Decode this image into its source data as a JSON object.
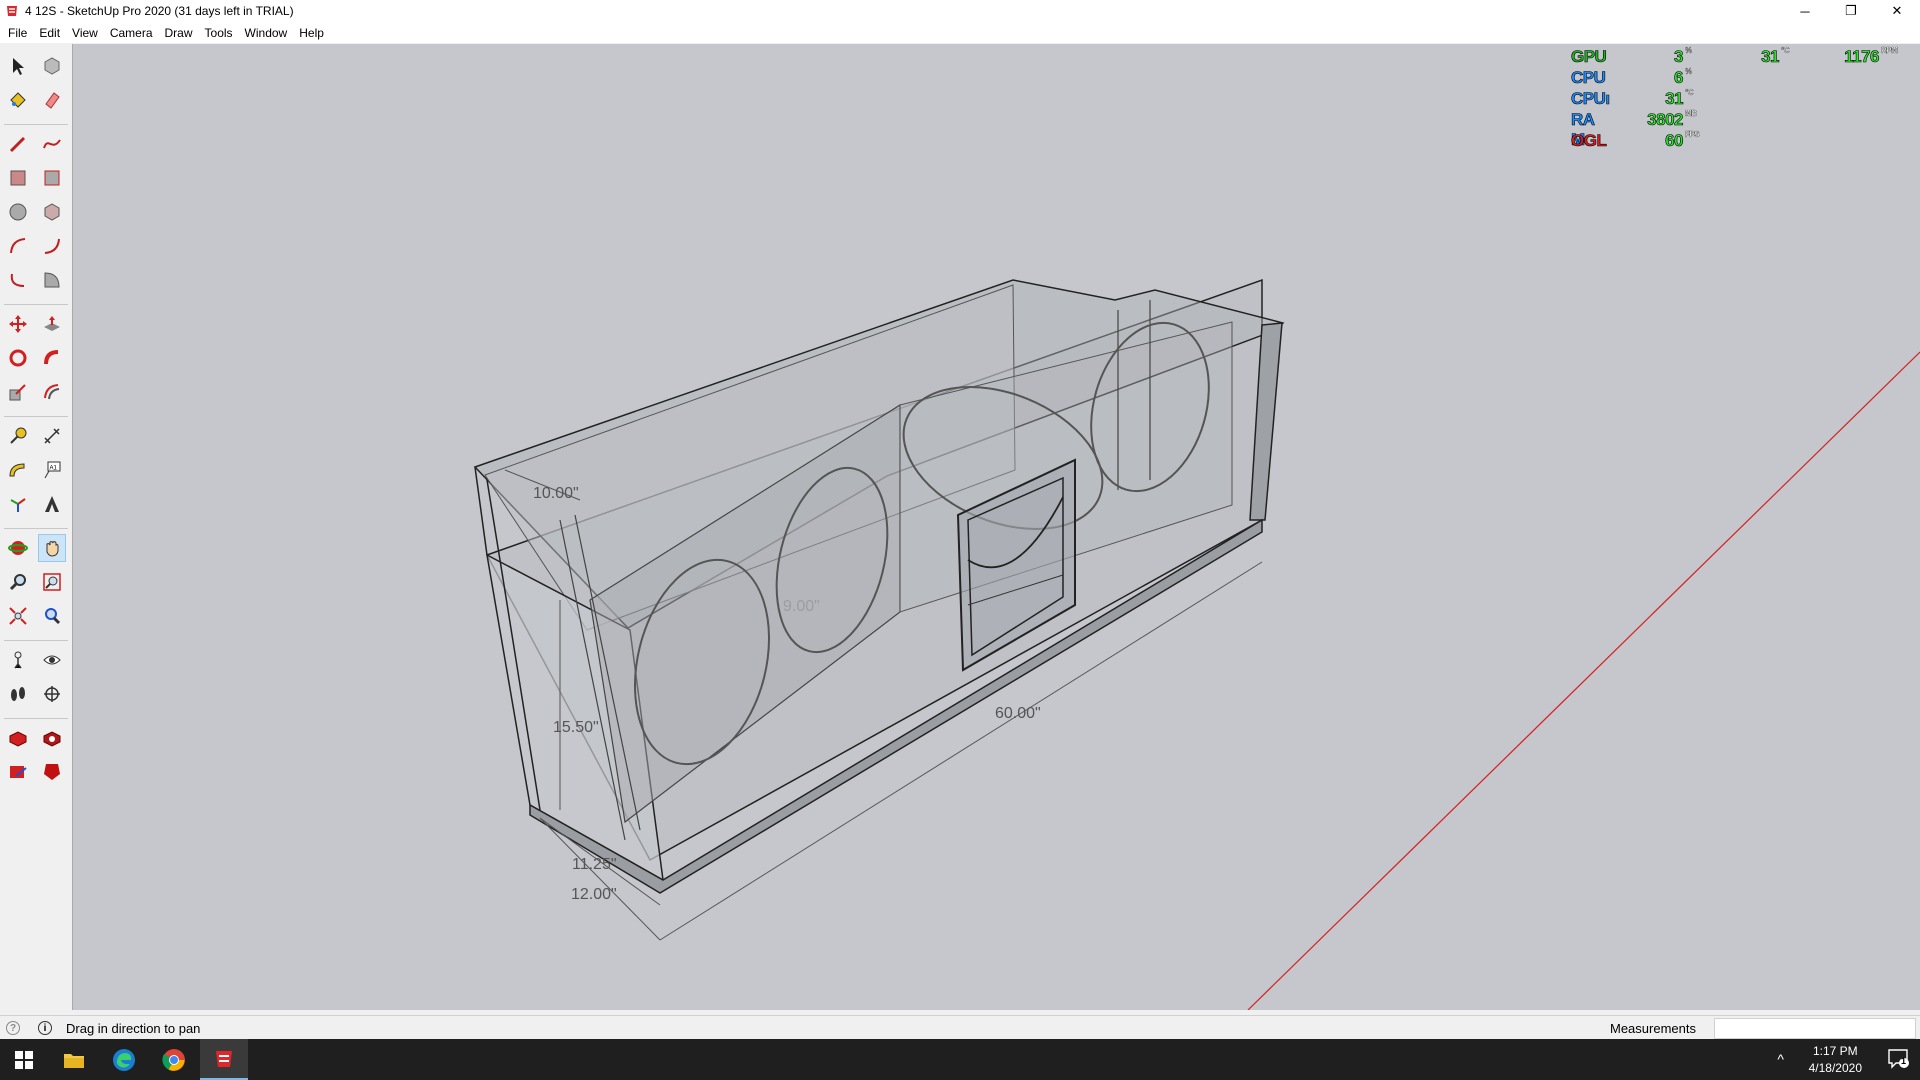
{
  "window": {
    "title": "4 12S - SketchUp Pro 2020 (31 days left in TRIAL)",
    "controls": {
      "minimize": "─",
      "restore": "❐",
      "close": "✕"
    }
  },
  "menu": [
    "File",
    "Edit",
    "View",
    "Camera",
    "Draw",
    "Tools",
    "Window",
    "Help"
  ],
  "toolbar": {
    "tools": [
      "select-icon",
      "component-icon",
      "paint-bucket-icon",
      "eraser-icon",
      "pencil-line-icon",
      "freehand-icon",
      "rectangle-icon",
      "rotated-rectangle-icon",
      "circle-icon",
      "polygon-icon",
      "arc-icon",
      "two-point-arc-icon",
      "three-point-arc-icon",
      "pie-icon",
      "move-icon",
      "push-pull-icon",
      "rotate-icon",
      "follow-me-icon",
      "scale-icon",
      "offset-icon",
      "tape-measure-icon",
      "dimension-icon",
      "protractor-icon",
      "text-icon",
      "axes-icon",
      "3d-text-icon",
      "orbit-icon",
      "pan-icon",
      "zoom-icon",
      "zoom-window-icon",
      "zoom-extents-icon",
      "previous-view-icon",
      "position-camera-icon",
      "look-around-icon",
      "walk-icon",
      "section-plane-icon",
      "3d-warehouse-icon",
      "extension-warehouse-icon",
      "share-model-icon",
      "layout-icon"
    ],
    "active_tool": "pan-icon"
  },
  "hud": {
    "rows": [
      {
        "label": "GPU",
        "label_color": "#1fb51f",
        "value": "3",
        "unit": "%"
      },
      {
        "label": "CPU",
        "label_color": "#1a8cff",
        "value": "6",
        "unit": "%"
      },
      {
        "label": "CPUı",
        "label_color": "#1a8cff",
        "value": "31",
        "unit": "°C"
      },
      {
        "label": "RA M",
        "label_color": "#1a8cff",
        "value": "3802",
        "unit": "MB"
      },
      {
        "label": "OGL",
        "label_color": "#e01b1b",
        "value": "60",
        "unit": "FPS"
      }
    ],
    "gpu_temp": {
      "value": "31",
      "unit": "°C"
    },
    "gpu_fan": {
      "value": "1176",
      "unit": "RPM"
    }
  },
  "dimensions": {
    "depth_top": "10.00\"",
    "inner": "9.00\"",
    "height": "15.50\"",
    "length": "60.00\"",
    "depth_inner": "11.25\"",
    "depth_outer": "12.00\""
  },
  "statusbar": {
    "hint": "Drag in direction to pan",
    "measurements_label": "Measurements",
    "measurements_value": ""
  },
  "taskbar": {
    "apps": [
      "windows-start-icon",
      "file-explorer-icon",
      "edge-icon",
      "chrome-icon",
      "sketchup-icon"
    ],
    "active_app": "sketchup-icon",
    "tray_chevron": "^",
    "time": "1:17 PM",
    "date": "4/18/2020",
    "notification_count": "1"
  },
  "colors": {
    "viewport_bg": "#c5c7cc",
    "red_axis": "#d42020",
    "hud_value": "#2ee62e",
    "taskbar_bg": "#1f1f1f"
  }
}
